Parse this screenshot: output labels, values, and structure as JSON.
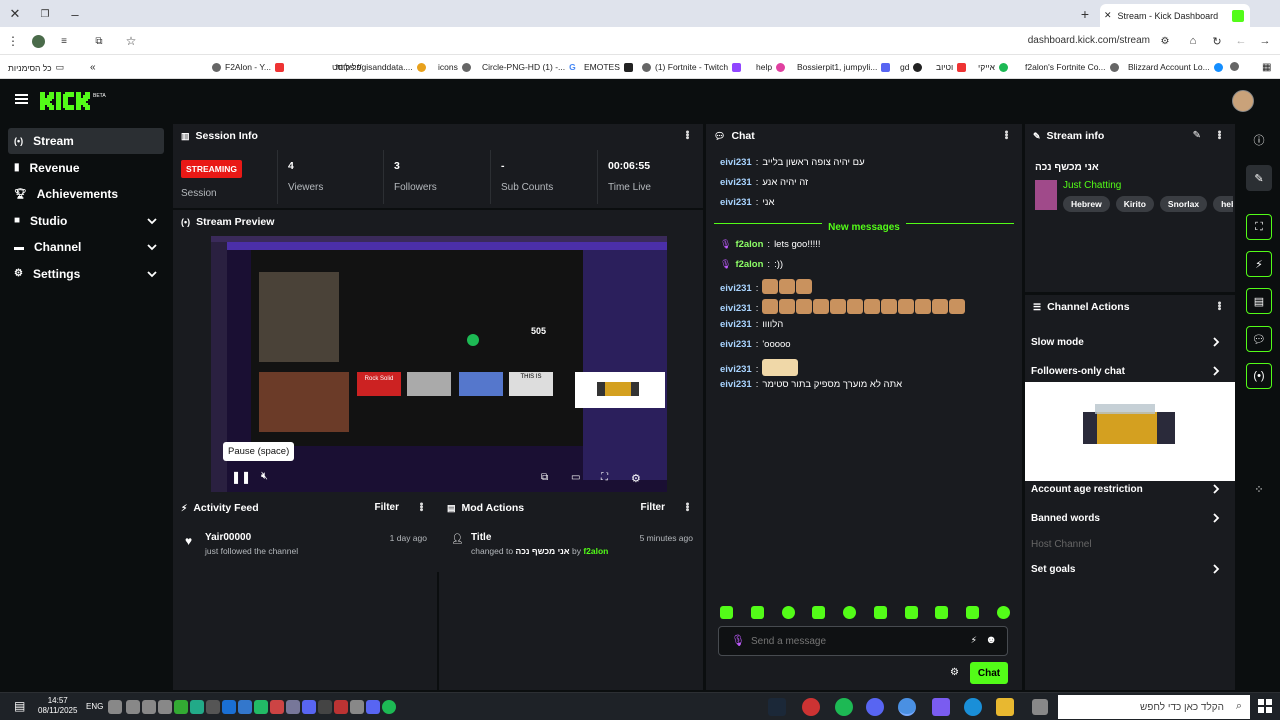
{
  "browser": {
    "tab_title": "Stream - Kick Dashboard",
    "url": "dashboard.kick.com/stream",
    "bookmarks": [
      "כל הסימניות",
      "F2Alon - Y...",
      "פליליסט",
      "https://gisanddata....",
      "icons",
      "Circle-PNG-HD (1) -...",
      "EMOTES",
      "(1) Fortnite - Twitch",
      "help",
      "Bossierpit1, jumpyli...",
      "gd",
      "וטיוב",
      "אייקי",
      "f2alon's Fortnite Co...",
      "Blizzard Account Lo..."
    ]
  },
  "sidebar": {
    "items": [
      {
        "label": "Stream",
        "icon": "broadcast-icon"
      },
      {
        "label": "Revenue",
        "icon": "dollar-icon"
      },
      {
        "label": "Achievements",
        "icon": "trophy-icon"
      },
      {
        "label": "Studio",
        "icon": "camera-icon"
      },
      {
        "label": "Channel",
        "icon": "tv-icon"
      },
      {
        "label": "Settings",
        "icon": "gear-icon"
      }
    ]
  },
  "session": {
    "title": "Session Info",
    "badge": "STREAMING",
    "session_label": "Session",
    "stats": [
      {
        "value": "4",
        "label": "Viewers"
      },
      {
        "value": "3",
        "label": "Followers"
      },
      {
        "value": "-",
        "label": "Sub Counts"
      },
      {
        "value": "00:06:55",
        "label": "Time Live"
      }
    ]
  },
  "preview": {
    "title": "Stream Preview",
    "tooltip": "Pause (space)",
    "player_label": "505",
    "album1": "Rock Solid",
    "album2": "THIS IS"
  },
  "activity": {
    "title": "Activity Feed",
    "filter": "Filter",
    "item": {
      "user": "Yair00000",
      "text": "just followed the channel",
      "time": "1 day ago"
    }
  },
  "mod": {
    "title": "Mod Actions",
    "filter": "Filter",
    "item": {
      "title": "Title",
      "changed_to": "changed to",
      "value": "אני מכשף נכה",
      "by": "by",
      "user": "f2alon",
      "time": "5 minutes ago"
    }
  },
  "chat": {
    "title": "Chat",
    "messages": [
      {
        "user": "eivi231",
        "text": "עם יהיה צופה ראשון בלייב"
      },
      {
        "user": "eivi231",
        "text": "זה יהיה אנע"
      },
      {
        "user": "eivi231",
        "text": "אני"
      }
    ],
    "new_messages": "New messages",
    "new": [
      {
        "user": "f2alon",
        "text": "lets goo!!!!!"
      },
      {
        "user": "f2alon",
        "text": ":))"
      },
      {
        "user": "eivi231",
        "text": ""
      },
      {
        "user": "eivi231",
        "text": ""
      },
      {
        "user": "eivi231",
        "text": "הלוווו"
      },
      {
        "user": "eivi231",
        "text": "'ooooo"
      },
      {
        "user": "eivi231",
        "text": ""
      },
      {
        "user": "eivi231",
        "text": "אתה לא מוערך מספיק בתור סטימר"
      }
    ],
    "placeholder": "Send a message",
    "send": "Chat"
  },
  "stream_info": {
    "title": "Stream info",
    "stream_title": "אני מכשף נכה",
    "category": "Just Chatting",
    "tags": [
      "Hebrew",
      "Kirito",
      "Snorlax",
      "hebrew"
    ]
  },
  "channel_actions": {
    "title": "Channel Actions",
    "items": [
      {
        "label": "Slow mode",
        "enabled": true
      },
      {
        "label": "Followers-only chat",
        "enabled": true
      },
      {
        "label": "Account age restriction",
        "enabled": true
      },
      {
        "label": "Banned words",
        "enabled": true
      },
      {
        "label": "Host Channel",
        "enabled": false
      },
      {
        "label": "Set goals",
        "enabled": true
      }
    ]
  },
  "taskbar": {
    "time": "14:57",
    "date": "08/11/2025",
    "lang": "ENG",
    "search": "הקלד כאן כדי לחפש"
  },
  "colors": {
    "accent": "#53fc18",
    "live": "#e91916",
    "panel": "#191b1f"
  }
}
